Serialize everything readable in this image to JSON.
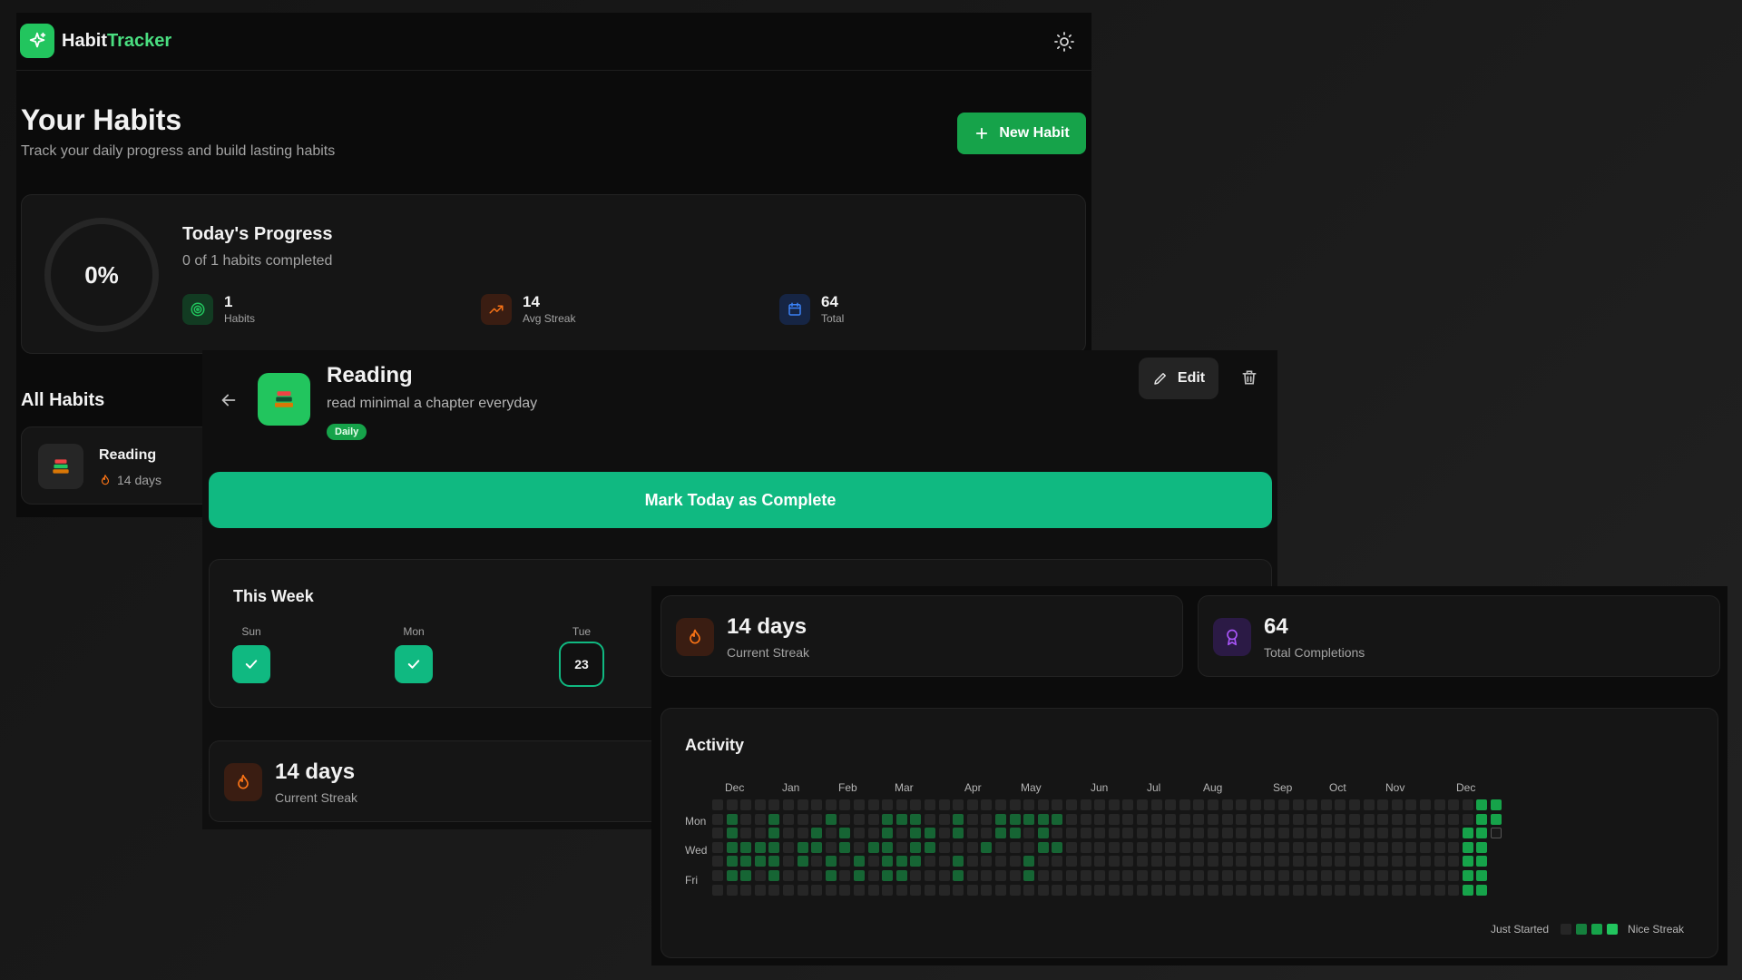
{
  "brand": {
    "part1": "Habit",
    "part2": "Tracker"
  },
  "page": {
    "title": "Your Habits",
    "subtitle": "Track your daily progress and build lasting habits",
    "new_habit_label": "New Habit"
  },
  "progress": {
    "percent_label": "0%",
    "title": "Today's Progress",
    "subtitle": "0 of 1 habits completed",
    "stats": [
      {
        "value": "1",
        "label": "Habits",
        "icon": "target-icon",
        "color": "#22c55e"
      },
      {
        "value": "14",
        "label": "Avg Streak",
        "icon": "trending-up-icon",
        "color": "#f97316"
      },
      {
        "value": "64",
        "label": "Total",
        "icon": "calendar-icon",
        "color": "#3b82f6"
      }
    ]
  },
  "all_habits": {
    "title": "All Habits",
    "items": [
      {
        "name": "Reading",
        "streak": "14 days",
        "icon": "books-icon"
      }
    ]
  },
  "detail": {
    "title": "Reading",
    "description": "read minimal a chapter everyday",
    "badge": "Daily",
    "edit_label": "Edit",
    "mark_label": "Mark Today as Complete",
    "week_title": "This Week",
    "week": [
      {
        "day": "Sun",
        "done": true,
        "text": ""
      },
      {
        "day": "Mon",
        "done": true,
        "text": ""
      },
      {
        "day": "Tue",
        "done": false,
        "text": "23"
      }
    ],
    "streak_value": "14 days",
    "streak_label": "Current Streak"
  },
  "stats_panel": {
    "current_streak_value": "14 days",
    "current_streak_label": "Current Streak",
    "total_value": "64",
    "total_label": "Total Completions",
    "activity_title": "Activity",
    "months": [
      "Dec",
      "Jan",
      "Feb",
      "Mar",
      "Apr",
      "May",
      "Jun",
      "Jul",
      "Aug",
      "Sep",
      "Oct",
      "Nov",
      "Dec"
    ],
    "day_labels": [
      "Mon",
      "Wed",
      "Fri"
    ],
    "legend_start": "Just Started",
    "legend_end": "Nice Streak",
    "colors": {
      "empty": "#262626",
      "l1": "#166534",
      "l2": "#15803d",
      "l3": "#16a34a",
      "l4": "#22c55e"
    },
    "activity_weeks": 56,
    "active_cells": [
      [
        1,
        1
      ],
      [
        1,
        2
      ],
      [
        1,
        3
      ],
      [
        1,
        4
      ],
      [
        1,
        5
      ],
      [
        2,
        3
      ],
      [
        2,
        4
      ],
      [
        2,
        5
      ],
      [
        3,
        3
      ],
      [
        3,
        4
      ],
      [
        4,
        1
      ],
      [
        4,
        2
      ],
      [
        4,
        3
      ],
      [
        4,
        4
      ],
      [
        4,
        5
      ],
      [
        6,
        3
      ],
      [
        6,
        4
      ],
      [
        7,
        2
      ],
      [
        7,
        3
      ],
      [
        8,
        1
      ],
      [
        8,
        4
      ],
      [
        8,
        5
      ],
      [
        9,
        2
      ],
      [
        9,
        3
      ],
      [
        10,
        4
      ],
      [
        10,
        5
      ],
      [
        11,
        3
      ],
      [
        12,
        1
      ],
      [
        12,
        2
      ],
      [
        12,
        3
      ],
      [
        12,
        4
      ],
      [
        12,
        5
      ],
      [
        13,
        1
      ],
      [
        13,
        4
      ],
      [
        13,
        5
      ],
      [
        14,
        1
      ],
      [
        14,
        2
      ],
      [
        14,
        3
      ],
      [
        14,
        4
      ],
      [
        15,
        2
      ],
      [
        15,
        3
      ],
      [
        17,
        1
      ],
      [
        17,
        2
      ],
      [
        17,
        4
      ],
      [
        17,
        5
      ],
      [
        19,
        3
      ],
      [
        20,
        1
      ],
      [
        20,
        2
      ],
      [
        21,
        1
      ],
      [
        21,
        2
      ],
      [
        22,
        1
      ],
      [
        22,
        4
      ],
      [
        22,
        5
      ],
      [
        23,
        1
      ],
      [
        23,
        2
      ],
      [
        23,
        3
      ],
      [
        24,
        1
      ],
      [
        24,
        3
      ],
      [
        53,
        2
      ],
      [
        53,
        3
      ],
      [
        53,
        4
      ],
      [
        53,
        5
      ],
      [
        53,
        6
      ],
      [
        54,
        0
      ],
      [
        54,
        1
      ],
      [
        54,
        2
      ],
      [
        54,
        3
      ],
      [
        54,
        4
      ],
      [
        54,
        5
      ],
      [
        54,
        6
      ],
      [
        55,
        0
      ],
      [
        55,
        1
      ]
    ],
    "today_cell": [
      55,
      2
    ]
  }
}
